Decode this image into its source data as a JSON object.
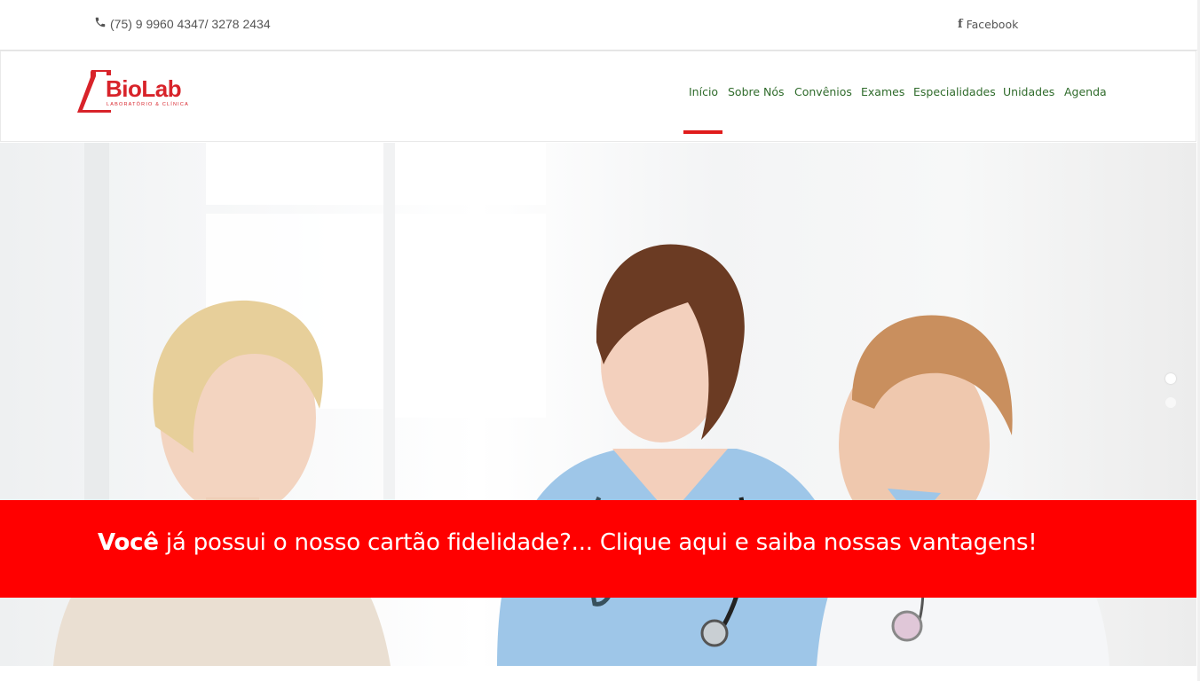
{
  "topbar": {
    "phone_icon": "phone-icon",
    "phone": "(75) 9 9960 4347/ 3278 2434",
    "facebook_icon": "facebook-icon",
    "facebook_glyph": "f",
    "facebook_label": "Facebook"
  },
  "logo": {
    "name": "BioLab",
    "tagline": "LABORATÓRIO & CLÍNICA",
    "color": "#d8232a"
  },
  "nav": {
    "items": [
      {
        "label": "Início",
        "active": true
      },
      {
        "label": "Sobre Nós"
      },
      {
        "label": "Convênios"
      },
      {
        "label": "Exames"
      },
      {
        "label": "Especialidades"
      },
      {
        "label": "Unidades"
      },
      {
        "label": "Agenda"
      }
    ],
    "color": "#2f6b2b",
    "active_indicator_color": "#e01c1c"
  },
  "banner": {
    "bold": "Você",
    "text": " já possui o nosso cartão fidelidade?...  Clique aqui e saiba nossas vantagens!",
    "background": "#ff0000"
  },
  "slider": {
    "dots": 2,
    "active_dot": 1
  }
}
